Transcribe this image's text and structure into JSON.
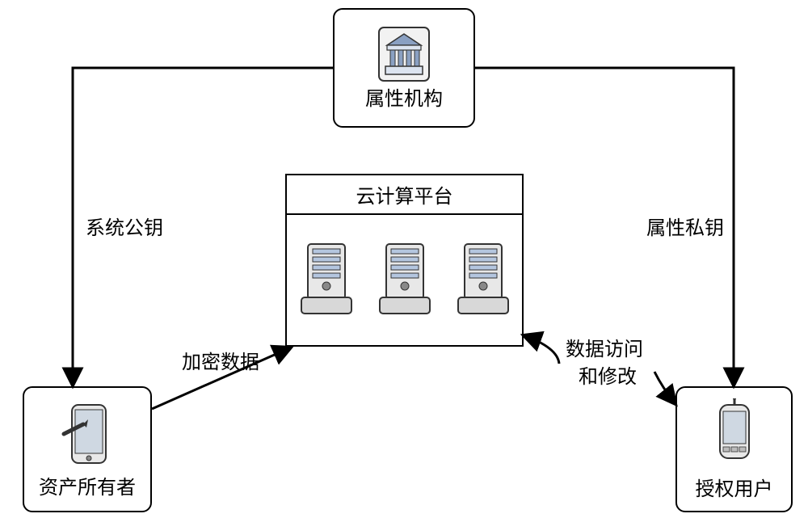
{
  "diagram": {
    "nodes": {
      "authority": {
        "label": "属性机构"
      },
      "cloud": {
        "label": "云计算平台"
      },
      "owner": {
        "label": "资产所有者"
      },
      "user": {
        "label": "授权用户"
      }
    },
    "edges": {
      "authority_to_owner": {
        "label": "系统公钥"
      },
      "authority_to_user": {
        "label": "属性私钥"
      },
      "owner_to_cloud": {
        "label": "加密数据"
      },
      "user_to_cloud_l1": {
        "label": "数据访问"
      },
      "user_to_cloud_l2": {
        "label": "和修改"
      }
    }
  }
}
